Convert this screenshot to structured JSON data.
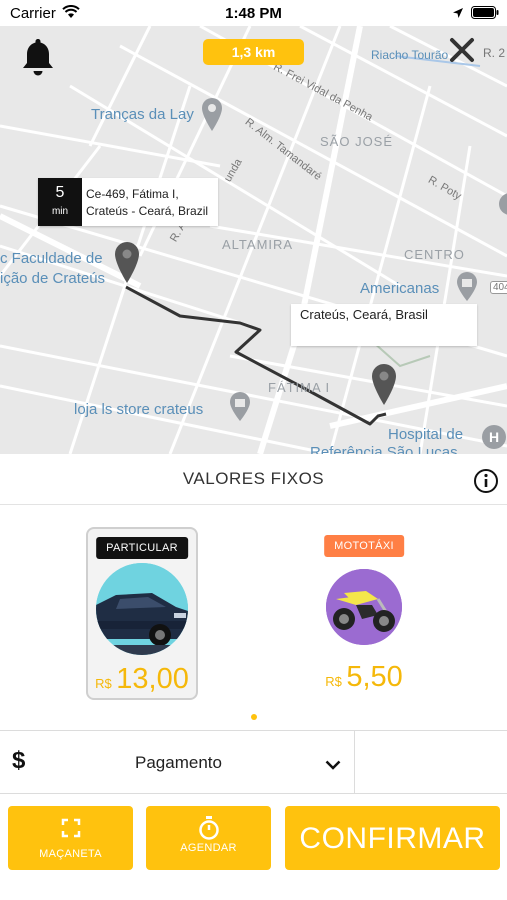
{
  "status_bar": {
    "carrier": "Carrier",
    "time": "1:48 PM"
  },
  "map": {
    "distance": "1,3 km",
    "labels": {
      "riacho": "Riacho Tourão",
      "trancas": "Tranças da Lay",
      "sao_jose": "SÃO JOSÉ",
      "altamira": "ALTAMIRA",
      "centro": "CENTRO",
      "americanas": "Americanas",
      "faculdade_1": "c Faculdade de",
      "faculdade_2": "ição de Crateús",
      "fatima": "FÁTIMA I",
      "loja": "loja ls store crateus",
      "hospital_1": "Hospital de",
      "hospital_2": "Referência São Lucas",
      "r_frei": "R. Frei Vidal da Penha",
      "r_alm": "R. Alm. Tamandaré",
      "r_poty": "R. Poty",
      "r_a": "R. A",
      "r_unda": "unda",
      "road_404": "404",
      "r_2": "R. 2"
    },
    "origin_callout": {
      "eta_value": "5",
      "eta_unit": "min",
      "address": "Ce-469, Fátima I, Crateús - Ceará, Brazil"
    },
    "dest_callout": {
      "address": "Crateús, Ceará, Brasil"
    }
  },
  "section": {
    "title": "VALORES FIXOS"
  },
  "vehicles": [
    {
      "badge": "PARTICULAR",
      "currency": "R$",
      "price": "13,00",
      "selected": true
    },
    {
      "badge": "MOTOTÁXI",
      "currency": "R$",
      "price": "5,50",
      "selected": false
    }
  ],
  "payment": {
    "icon": "$",
    "label": "Pagamento"
  },
  "actions": {
    "macaneta": "MAÇANETA",
    "agendar": "AGENDAR",
    "confirmar": "CONFIRMAR"
  },
  "colors": {
    "accent": "#ffc20e",
    "moto_badge": "#ff7f45",
    "car_circle": "#6fd3e0",
    "moto_circle": "#9b6bd1"
  }
}
